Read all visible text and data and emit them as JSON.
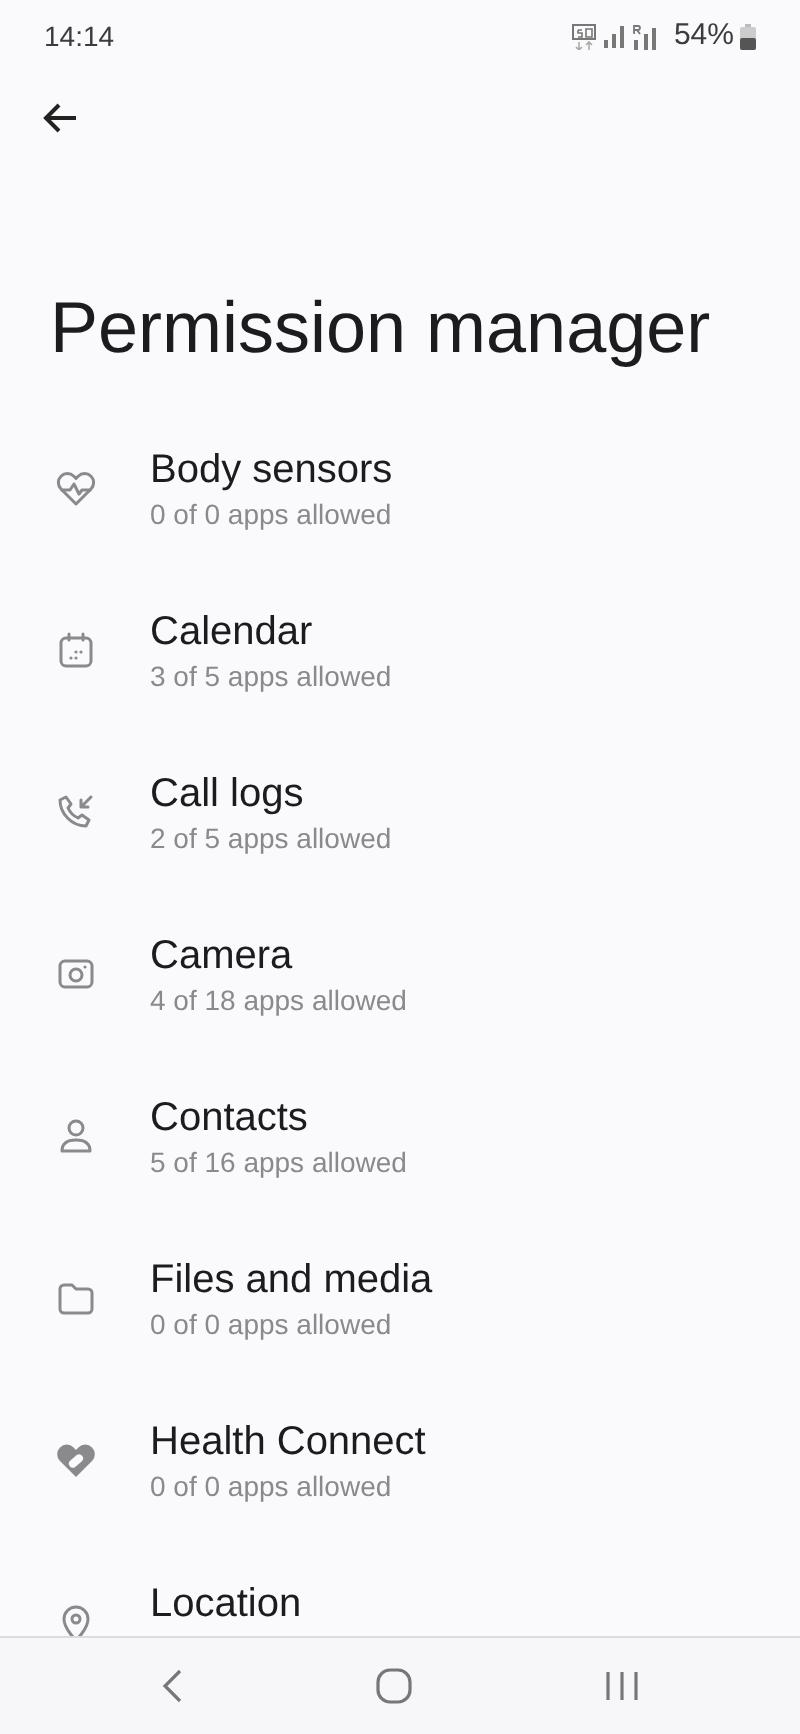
{
  "status_bar": {
    "time": "14:14",
    "battery": "54%"
  },
  "title": "Permission manager",
  "permissions": [
    {
      "name": "Body sensors",
      "summary": "0 of 0 apps allowed"
    },
    {
      "name": "Calendar",
      "summary": "3 of 5 apps allowed"
    },
    {
      "name": "Call logs",
      "summary": "2 of 5 apps allowed"
    },
    {
      "name": "Camera",
      "summary": "4 of 18 apps allowed"
    },
    {
      "name": "Contacts",
      "summary": "5 of 16 apps allowed"
    },
    {
      "name": "Files and media",
      "summary": "0 of 0 apps allowed"
    },
    {
      "name": "Health Connect",
      "summary": "0 of 0 apps allowed"
    },
    {
      "name": "Location"
    }
  ]
}
